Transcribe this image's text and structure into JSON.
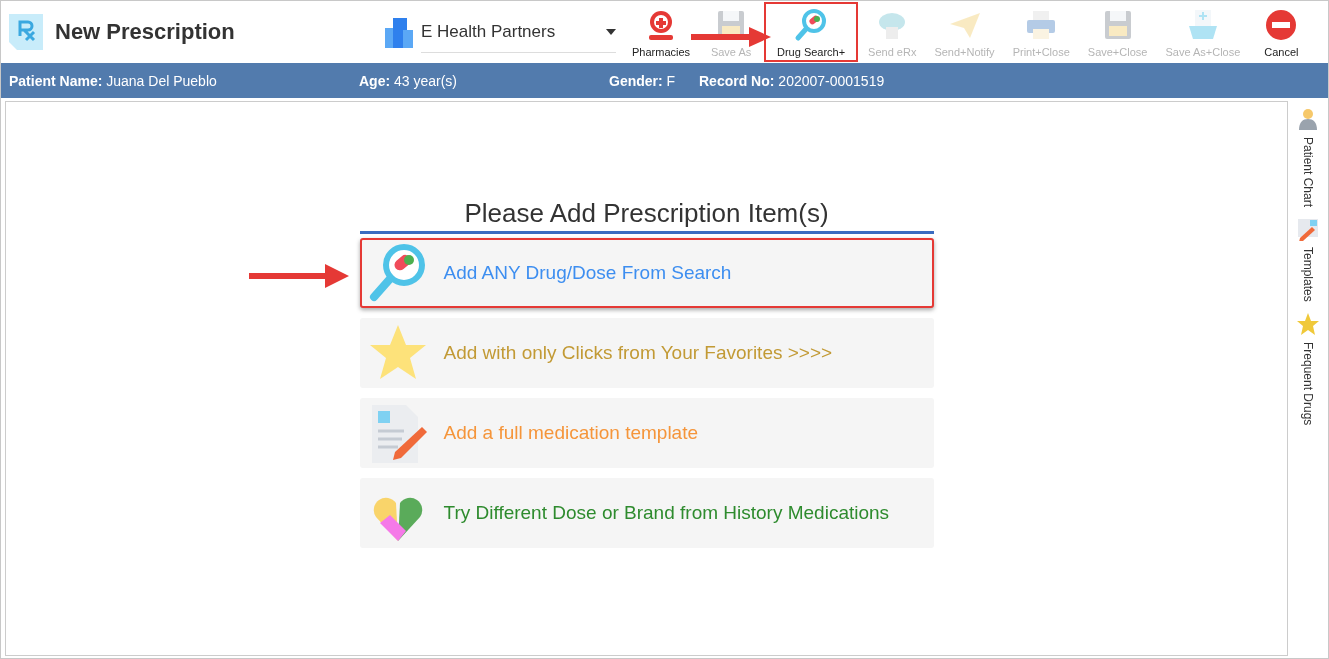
{
  "window": {
    "title": "New Prescription"
  },
  "clinic": {
    "value": "E Health Partners"
  },
  "toolbar": [
    {
      "kind": "pharmacy",
      "label": "Pharmacies",
      "disabled": false,
      "highlighted": false
    },
    {
      "kind": "save",
      "label": "Save As",
      "disabled": true,
      "highlighted": false
    },
    {
      "kind": "drug-search",
      "label": "Drug Search+",
      "disabled": false,
      "highlighted": true
    },
    {
      "kind": "cloud",
      "label": "Send eRx",
      "disabled": true,
      "highlighted": false
    },
    {
      "kind": "plane",
      "label": "Send+Notify",
      "disabled": true,
      "highlighted": false
    },
    {
      "kind": "printer",
      "label": "Print+Close",
      "disabled": true,
      "highlighted": false
    },
    {
      "kind": "disk",
      "label": "Save+Close",
      "disabled": true,
      "highlighted": false
    },
    {
      "kind": "folder",
      "label": "Save As+Close",
      "disabled": true,
      "highlighted": false
    },
    {
      "kind": "cancel",
      "label": "Cancel",
      "disabled": false,
      "highlighted": false
    }
  ],
  "patient_bar": [
    {
      "label": "Patient Name:",
      "value": "Juana Del Pueblo"
    },
    {
      "label": "Age:",
      "value": "43 year(s)"
    },
    {
      "label": "Gender:",
      "value": "F"
    },
    {
      "label": "Record No:",
      "value": "202007-0001519"
    }
  ],
  "main": {
    "heading": "Please Add Prescription Item(s)",
    "options": [
      {
        "kind": "search",
        "label": "Add ANY Drug/Dose From Search",
        "color": "#3d8ef0",
        "highlighted": true
      },
      {
        "kind": "star",
        "label": "Add with only Clicks from Your Favorites >>>>",
        "color": "#c29a35",
        "highlighted": false
      },
      {
        "kind": "template",
        "label": "Add a full medication template",
        "color": "#f5953a",
        "highlighted": false
      },
      {
        "kind": "pills",
        "label": "Try Different Dose or Brand from History Medications",
        "color": "#2e8b2e",
        "highlighted": false
      }
    ]
  },
  "sidebar": [
    {
      "kind": "patient",
      "label": "Patient Chart"
    },
    {
      "kind": "template",
      "label": "Templates"
    },
    {
      "kind": "star",
      "label": "Frequent Drugs"
    }
  ]
}
